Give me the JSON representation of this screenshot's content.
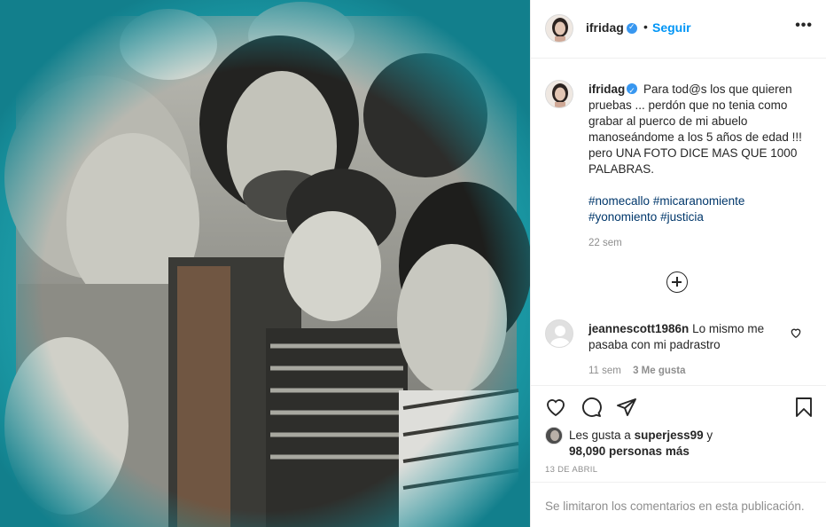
{
  "post": {
    "username": "ifridag",
    "follow_label": "Seguir",
    "separator": "•",
    "more_label": "•••",
    "caption_text": "Para tod@s los que quieren pruebas ... perdón que no tenia como grabar al puerco de mi abuelo manoseándome a los 5 años de edad !!! pero UNA FOTO DICE MAS QUE 1000 PALABRAS.",
    "hashtags": [
      "#nomecallo",
      "#micaranomiente",
      "#yonomiento",
      "#justicia"
    ],
    "caption_time": "22 sem"
  },
  "comments": [
    {
      "username": "jeannescott1986n",
      "text": "Lo mismo me pasaba con mi padrastro",
      "time": "11 sem",
      "likes": "3 Me gusta"
    }
  ],
  "likes_line": {
    "prefix": "Les gusta a",
    "user": "superjess99",
    "conjunction": "y",
    "count": "98,090 personas más"
  },
  "post_date": "13 DE ABRIL",
  "footer_text": "Se limitaron los comentarios en esta publicación.",
  "colors": {
    "photo_background": "#1b9aa6",
    "link_blue": "#0095f6",
    "hashtag_blue": "#00376b",
    "verified_blue": "#3897f0",
    "muted_gray": "#8e8e8e"
  },
  "icons": [
    "verified-badge-icon",
    "more-options-icon",
    "add-comment-icon",
    "heart-icon",
    "comment-icon",
    "share-icon",
    "bookmark-icon"
  ]
}
